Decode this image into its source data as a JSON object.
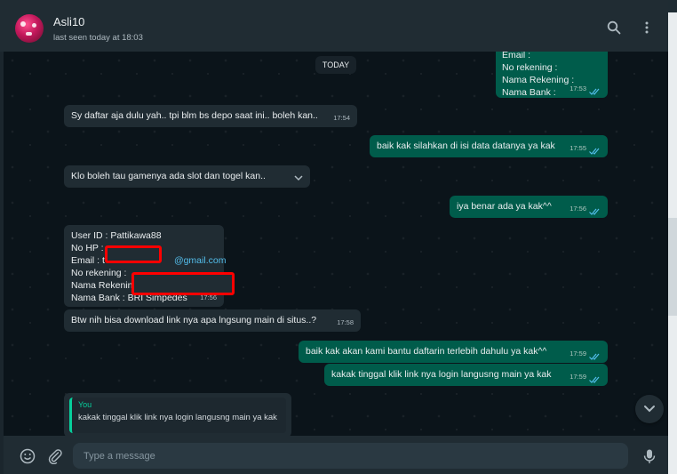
{
  "header": {
    "contact_name": "Asli10",
    "last_seen": "last seen today at 18:03",
    "icons": [
      "search-icon",
      "menu-icon"
    ]
  },
  "chat": {
    "date_chip": "TODAY",
    "top_partial": {
      "lines": [
        "Email :",
        "No rekening :",
        "Nama Rekening :",
        "Nama Bank :"
      ],
      "time": "17:53"
    },
    "messages": [
      {
        "dir": "in",
        "text": "Sy daftar aja dulu yah.. tpi blm bs depo saat ini.. boleh kan..",
        "time": "17:54"
      },
      {
        "dir": "out",
        "text": "baik kak silahkan di isi data datanya ya kak",
        "time": "17:55"
      },
      {
        "dir": "in",
        "text": "Klo boleh tau gamenya ada slot dan togel kan..",
        "time": ""
      },
      {
        "dir": "out",
        "text": "iya benar ada ya kak^^",
        "time": "17:56"
      },
      {
        "dir": "out",
        "text": "baik kak akan kami bantu daftarin terlebih dahulu ya kak^^",
        "time": "17:59"
      },
      {
        "dir": "out",
        "text": "kakak tinggal klik link nya login langusng main ya kak",
        "time": "17:59"
      },
      {
        "dir": "in",
        "text": "Btw nih bisa download link nya apa lngsung main di situs..?",
        "time": "17:58"
      }
    ],
    "form_message": {
      "user_id": "User ID : Pattikawa88",
      "no_hp": "No HP : ",
      "email_label": "Email : t",
      "email_domain": "@gmail.com",
      "no_rekening": "No rekening : ",
      "nama_rekening": "Nama Rekening : ",
      "nama_bank": "Nama Bank : BRI Simpedes",
      "time": "17:56"
    },
    "quoted_reply": {
      "author": "You",
      "text": "kakak tinggal klik link nya login langusng main ya kak"
    }
  },
  "composer": {
    "placeholder": "Type a message",
    "icons": [
      "emoji-icon",
      "attach-icon",
      "mic-icon"
    ]
  },
  "colors": {
    "incoming_bubble": "#202c33",
    "outgoing_bubble": "#005c4b",
    "read_ticks": "#53bdeb",
    "redaction": "#ff0000"
  }
}
